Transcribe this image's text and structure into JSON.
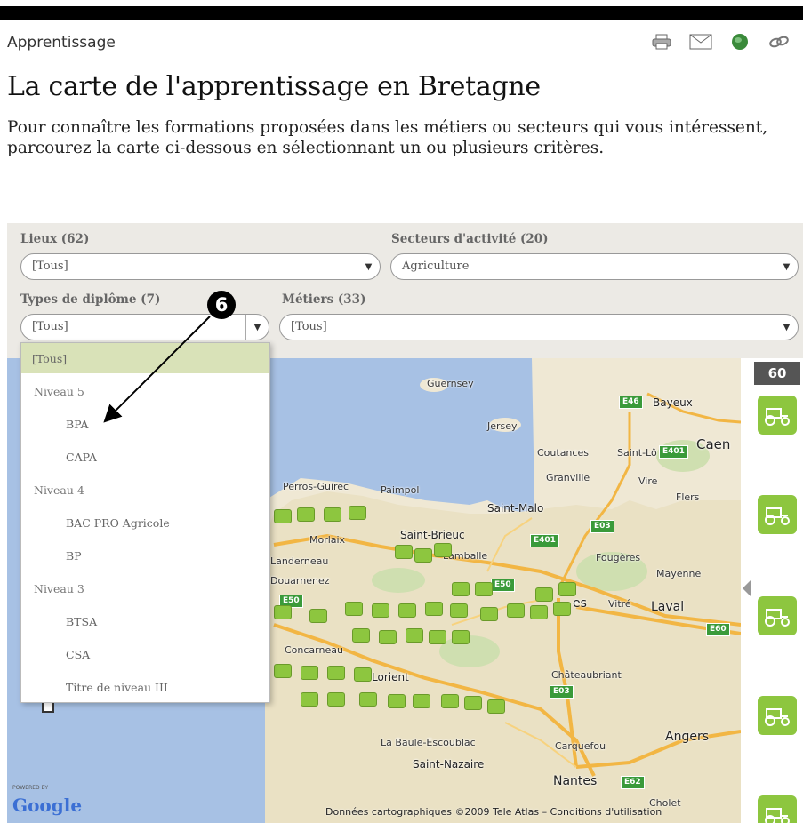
{
  "header": {
    "breadcrumb": "Apprentissage",
    "tool_icons": [
      "print-icon",
      "mail-icon",
      "globe-icon",
      "link-icon"
    ]
  },
  "page": {
    "title": "La carte de l'apprentissage en Bretagne",
    "intro": "Pour connaître les formations proposées dans les métiers ou secteurs qui vous intéressent, parcourez la carte ci-dessous en sélectionnant un ou plusieurs critères."
  },
  "filters": {
    "lieux": {
      "label": "Lieux (62)",
      "value": "[Tous]"
    },
    "secteurs": {
      "label": "Secteurs d'activité (20)",
      "value": "Agriculture"
    },
    "diplomes": {
      "label": "Types de diplôme (7)",
      "value": "[Tous]"
    },
    "metiers": {
      "label": "Métiers (33)",
      "value": "[Tous]"
    }
  },
  "dropdown": {
    "items": [
      {
        "label": "[Tous]",
        "kind": "option",
        "selected": true
      },
      {
        "label": "Niveau 5",
        "kind": "group"
      },
      {
        "label": "BPA",
        "kind": "option"
      },
      {
        "label": "CAPA",
        "kind": "option"
      },
      {
        "label": "Niveau 4",
        "kind": "group"
      },
      {
        "label": "BAC PRO Agricole",
        "kind": "option"
      },
      {
        "label": "BP",
        "kind": "option"
      },
      {
        "label": "Niveau 3",
        "kind": "group"
      },
      {
        "label": "BTSA",
        "kind": "option"
      },
      {
        "label": "CSA",
        "kind": "option"
      },
      {
        "label": "Titre de niveau III",
        "kind": "option"
      }
    ]
  },
  "annotation": {
    "number": "6"
  },
  "map": {
    "labels": {
      "guernsey": "Guernsey",
      "jersey": "Jersey",
      "bayeux": "Bayeux",
      "caen": "Caen",
      "saint_lo": "Saint-Lô",
      "coutances": "Coutances",
      "granville": "Granville",
      "vire": "Vire",
      "flers": "Flers",
      "perros": "Perros-Guirec",
      "paimpol": "Paimpol",
      "saint_malo": "Saint-Malo",
      "morlaix": "Morlaix",
      "saint_brieuc": "Saint-Brieuc",
      "lamballe": "Lamballe",
      "landerneau": "Landerneau",
      "fougeres": "Fougères",
      "mayenne": "Mayenne",
      "douarnenez": "Douarnenez",
      "vitre": "Vitré",
      "laval": "Laval",
      "concarneau": "Concarneau",
      "lorient": "Lorient",
      "chateaubriant": "Châteaubriant",
      "angers": "Angers",
      "la_baule": "La Baule-Escoublac",
      "saint_nazaire": "Saint-Nazaire",
      "carquefou": "Carquefou",
      "nantes": "Nantes",
      "cholet": "Cholet",
      "rennes_part": "es"
    },
    "roads": [
      "E46",
      "E401",
      "E401",
      "E03",
      "E50",
      "E50",
      "E03",
      "E60",
      "E62"
    ],
    "powered": "POWERED BY",
    "logo": "Google",
    "copyright": "Données cartographiques ©2009 Tele Atlas – Conditions d'utilisation"
  },
  "sidebar": {
    "count": "60"
  },
  "colors": {
    "accent_green": "#8dc63f",
    "selected_bg": "#d9e2b8",
    "filter_bg": "#eceae5",
    "sea": "#a7c1e4"
  }
}
